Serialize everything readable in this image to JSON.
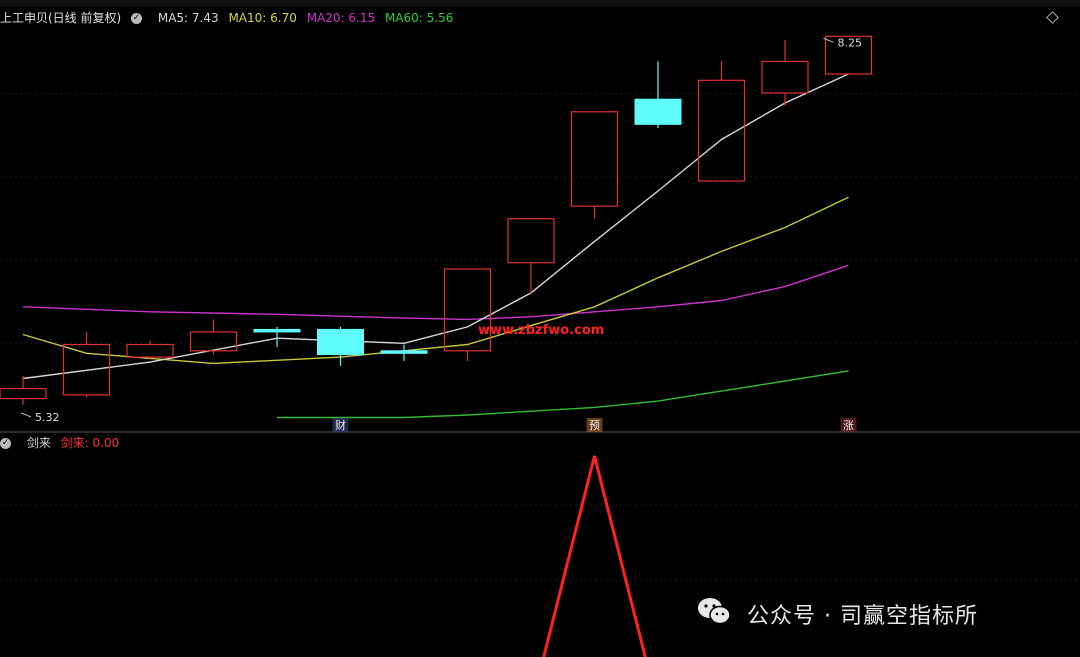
{
  "header": {
    "title": "上工申贝(日线 前复权)",
    "ma5_label": "MA5: 7.43",
    "ma10_label": "MA10: 6.70",
    "ma20_label": "MA20: 6.15",
    "ma60_label": "MA60: 5.56"
  },
  "indicator": {
    "name": "剑来",
    "value_label": "剑来: 0.00"
  },
  "watermark": {
    "text": "公众号 · 司赢空指标所"
  },
  "colors": {
    "bg": "#000000",
    "up": "#e03030",
    "down": "#5ffbfb",
    "ma5": "#d8d8d8",
    "ma10": "#c8c83a",
    "ma20": "#cc33cc",
    "ma60": "#33bb33",
    "signal": "#ff2020",
    "grid": "#2a2a2a",
    "site": "#ff2020"
  },
  "chart_data": {
    "type": "candlestick",
    "price_range": [
      5.2,
      8.3
    ],
    "high_label": "8.25",
    "low_label": "5.32",
    "candles": [
      {
        "o": 5.37,
        "c": 5.45,
        "h": 5.55,
        "l": 5.32,
        "dir": "up"
      },
      {
        "o": 5.4,
        "c": 5.8,
        "h": 5.9,
        "l": 5.38,
        "dir": "up"
      },
      {
        "o": 5.7,
        "c": 5.8,
        "h": 5.83,
        "l": 5.68,
        "dir": "up"
      },
      {
        "o": 5.75,
        "c": 5.9,
        "h": 6.0,
        "l": 5.72,
        "dir": "up"
      },
      {
        "o": 5.92,
        "c": 5.9,
        "h": 5.94,
        "l": 5.78,
        "dir": "down"
      },
      {
        "o": 5.92,
        "c": 5.72,
        "h": 5.94,
        "l": 5.63,
        "dir": "down"
      },
      {
        "o": 5.75,
        "c": 5.73,
        "h": 5.8,
        "l": 5.67,
        "dir": "down"
      },
      {
        "o": 5.75,
        "c": 6.4,
        "h": 6.4,
        "l": 5.67,
        "dir": "up"
      },
      {
        "o": 6.45,
        "c": 6.8,
        "h": 6.8,
        "l": 6.2,
        "dir": "up"
      },
      {
        "o": 6.9,
        "c": 7.65,
        "h": 7.65,
        "l": 6.8,
        "dir": "up"
      },
      {
        "o": 7.75,
        "c": 7.55,
        "h": 8.05,
        "l": 7.52,
        "dir": "down"
      },
      {
        "o": 7.1,
        "c": 7.9,
        "h": 8.05,
        "l": 7.1,
        "dir": "up"
      },
      {
        "o": 7.8,
        "c": 8.05,
        "h": 8.22,
        "l": 7.7,
        "dir": "up"
      },
      {
        "o": 7.95,
        "c": 8.25,
        "h": 8.25,
        "l": 7.95,
        "dir": "up"
      }
    ],
    "ma5": [
      [
        0,
        5.53
      ],
      [
        2,
        5.66
      ],
      [
        4,
        5.85
      ],
      [
        6,
        5.81
      ],
      [
        7,
        5.94
      ],
      [
        8,
        6.21
      ],
      [
        9,
        6.62
      ],
      [
        10,
        7.02
      ],
      [
        11,
        7.43
      ],
      [
        12,
        7.72
      ],
      [
        13,
        7.95
      ]
    ],
    "ma10": [
      [
        0,
        5.88
      ],
      [
        1,
        5.73
      ],
      [
        3,
        5.65
      ],
      [
        5,
        5.7
      ],
      [
        7,
        5.8
      ],
      [
        8,
        5.95
      ],
      [
        9,
        6.1
      ],
      [
        10,
        6.33
      ],
      [
        11,
        6.54
      ],
      [
        12,
        6.73
      ],
      [
        13,
        6.97
      ]
    ],
    "ma20": [
      [
        0,
        6.1
      ],
      [
        2,
        6.06
      ],
      [
        4,
        6.04
      ],
      [
        6,
        6.01
      ],
      [
        7,
        6.0
      ],
      [
        8,
        6.02
      ],
      [
        9,
        6.06
      ],
      [
        10,
        6.1
      ],
      [
        11,
        6.15
      ],
      [
        12,
        6.26
      ],
      [
        13,
        6.43
      ]
    ],
    "ma60": [
      [
        4,
        5.22
      ],
      [
        6,
        5.22
      ],
      [
        7,
        5.24
      ],
      [
        8,
        5.27
      ],
      [
        9,
        5.3
      ],
      [
        10,
        5.35
      ],
      [
        11,
        5.43
      ],
      [
        12,
        5.51
      ],
      [
        13,
        5.59
      ]
    ],
    "markers": [
      {
        "index": 5,
        "label": "财"
      },
      {
        "index": 9,
        "label": "预"
      },
      {
        "index": 13,
        "label": "涨"
      }
    ],
    "signal": {
      "peak_index": 9,
      "peak_value": 1,
      "range": [
        0,
        1
      ]
    }
  }
}
